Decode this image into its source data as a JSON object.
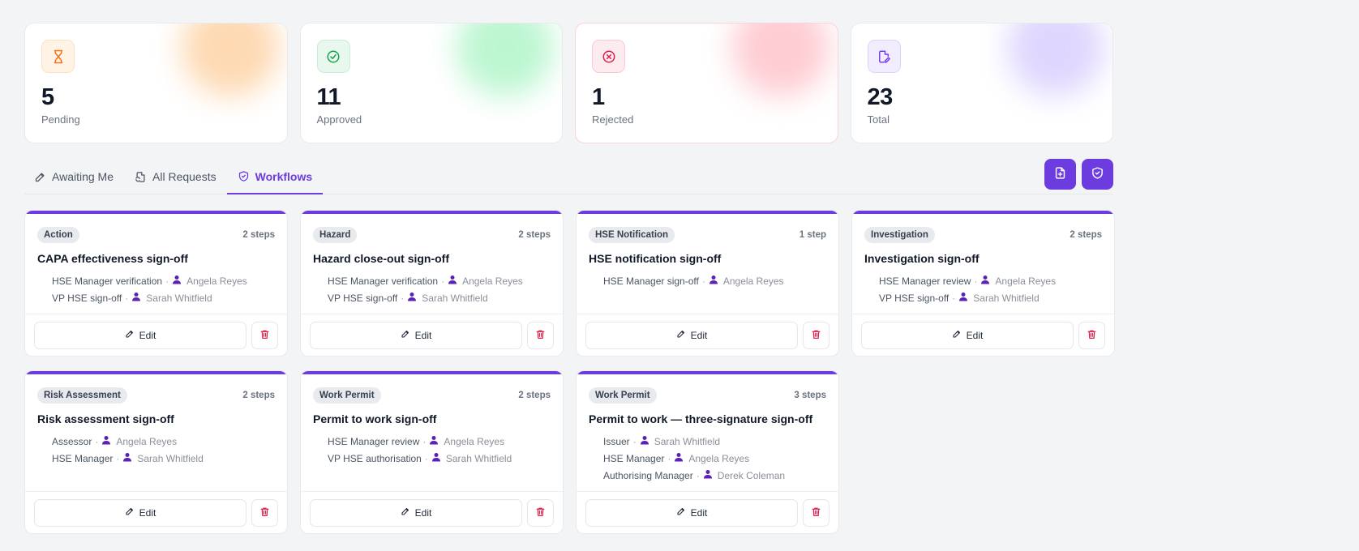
{
  "colors": {
    "accent": "#6d3ce0",
    "pending": "#f97316",
    "approved": "#16a34a",
    "rejected": "#e11d48",
    "total": "#7c3aed"
  },
  "stats": [
    {
      "key": "pending",
      "value": "5",
      "label": "Pending",
      "icon": "hourglass-icon"
    },
    {
      "key": "approved",
      "value": "11",
      "label": "Approved",
      "icon": "check-circle-icon"
    },
    {
      "key": "rejected",
      "value": "1",
      "label": "Rejected",
      "icon": "x-circle-icon"
    },
    {
      "key": "total",
      "value": "23",
      "label": "Total",
      "icon": "file-edit-icon"
    }
  ],
  "tabs": [
    {
      "label": "Awaiting Me",
      "icon": "pencil-icon",
      "active": false
    },
    {
      "label": "All Requests",
      "icon": "file-refresh-icon",
      "active": false
    },
    {
      "label": "Workflows",
      "icon": "shield-check-icon",
      "active": true
    }
  ],
  "toolbar": {
    "new_request_icon": "file-plus-icon",
    "new_workflow_icon": "shield-check-icon"
  },
  "edit_label": "Edit",
  "workflows": [
    {
      "category": "Action",
      "steps": "2 steps",
      "title": "CAPA effectiveness sign-off",
      "approvers": [
        {
          "role": "HSE Manager verification",
          "user": "Angela Reyes"
        },
        {
          "role": "VP HSE sign-off",
          "user": "Sarah Whitfield"
        }
      ]
    },
    {
      "category": "Hazard",
      "steps": "2 steps",
      "title": "Hazard close-out sign-off",
      "approvers": [
        {
          "role": "HSE Manager verification",
          "user": "Angela Reyes"
        },
        {
          "role": "VP HSE sign-off",
          "user": "Sarah Whitfield"
        }
      ]
    },
    {
      "category": "HSE Notification",
      "steps": "1 step",
      "title": "HSE notification sign-off",
      "approvers": [
        {
          "role": "HSE Manager sign-off",
          "user": "Angela Reyes"
        }
      ]
    },
    {
      "category": "Investigation",
      "steps": "2 steps",
      "title": "Investigation sign-off",
      "approvers": [
        {
          "role": "HSE Manager review",
          "user": "Angela Reyes"
        },
        {
          "role": "VP HSE sign-off",
          "user": "Sarah Whitfield"
        }
      ]
    },
    {
      "category": "Risk Assessment",
      "steps": "2 steps",
      "title": "Risk assessment sign-off",
      "approvers": [
        {
          "role": "Assessor",
          "user": "Angela Reyes"
        },
        {
          "role": "HSE Manager",
          "user": "Sarah Whitfield"
        }
      ]
    },
    {
      "category": "Work Permit",
      "steps": "2 steps",
      "title": "Permit to work sign-off",
      "approvers": [
        {
          "role": "HSE Manager review",
          "user": "Angela Reyes"
        },
        {
          "role": "VP HSE authorisation",
          "user": "Sarah Whitfield"
        }
      ]
    },
    {
      "category": "Work Permit",
      "steps": "3 steps",
      "title": "Permit to work — three-signature sign-off",
      "approvers": [
        {
          "role": "Issuer",
          "user": "Sarah Whitfield"
        },
        {
          "role": "HSE Manager",
          "user": "Angela Reyes"
        },
        {
          "role": "Authorising Manager",
          "user": "Derek Coleman"
        }
      ]
    }
  ]
}
